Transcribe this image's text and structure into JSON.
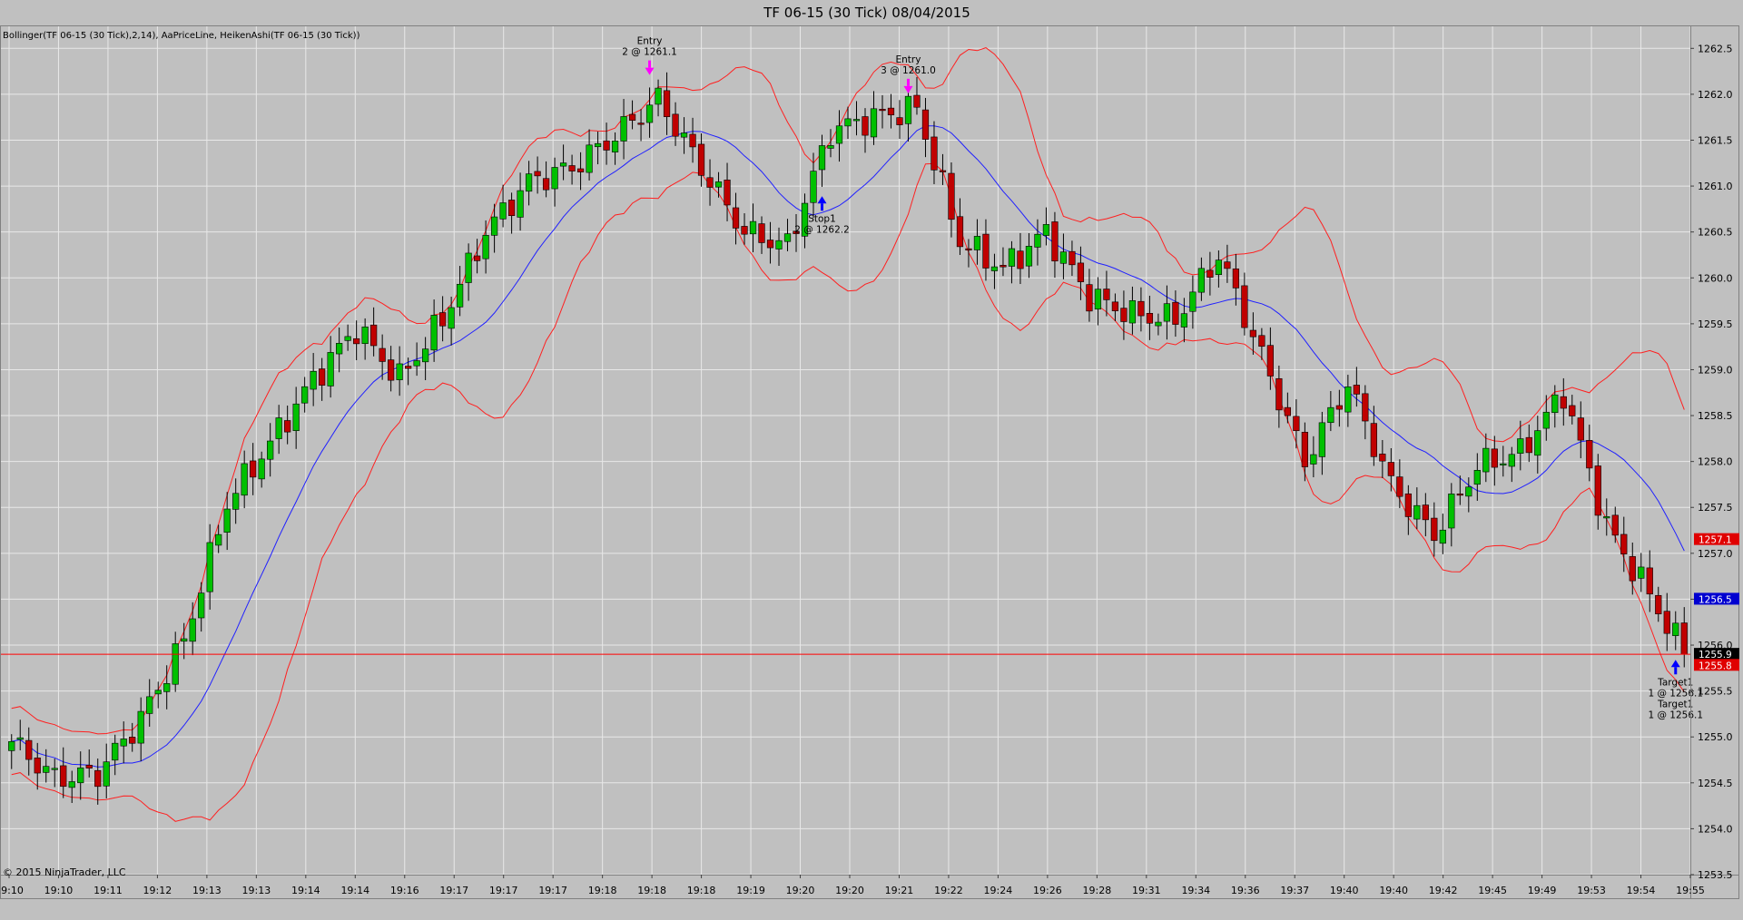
{
  "header": {
    "title": "TF 06-15 (30 Tick)  08/04/2015",
    "indicators": "Bollinger(TF 06-15 (30 Tick),2,14), AaPriceLine, HeikenAshi(TF 06-15 (30 Tick))",
    "copyright": "© 2015 NinjaTrader, LLC"
  },
  "colors": {
    "background": "#c0c0c0",
    "grid": "#e8e8e8",
    "up_candle": "#00c000",
    "down_candle": "#c00000",
    "upper_band": "#ff2020",
    "lower_band": "#ff2020",
    "middle_band": "#2020ff",
    "price_line": "#ff0000",
    "marker_entry": "#ff00ff",
    "marker_stop": "#0000ff"
  },
  "chart_data": {
    "type": "candlestick",
    "title": "TF 06-15 (30 Tick)  08/04/2015",
    "ylim": [
      1253.5,
      1262.75
    ],
    "y_ticks": [
      "1253.5",
      "1254.0",
      "1254.5",
      "1255.0",
      "1255.5",
      "1256.0",
      "1256.5",
      "1257.0",
      "1257.5",
      "1258.0",
      "1258.5",
      "1259.0",
      "1259.5",
      "1260.0",
      "1260.5",
      "1261.0",
      "1261.5",
      "1262.0",
      "1262.5"
    ],
    "x_ticks": [
      "19:10",
      "19:10",
      "19:11",
      "19:12",
      "19:13",
      "19:13",
      "19:14",
      "19:14",
      "19:16",
      "19:17",
      "19:17",
      "19:17",
      "19:18",
      "19:18",
      "19:18",
      "19:19",
      "19:20",
      "19:20",
      "19:21",
      "19:22",
      "19:24",
      "19:26",
      "19:28",
      "19:31",
      "19:34",
      "19:36",
      "19:37",
      "19:40",
      "19:40",
      "19:42",
      "19:45",
      "19:49",
      "19:53",
      "19:54",
      "19:55"
    ],
    "close_path": [
      [
        0,
        1254.95
      ],
      [
        5,
        1254.55
      ],
      [
        10,
        1254.6
      ],
      [
        15,
        1255.2
      ],
      [
        20,
        1256.05
      ],
      [
        25,
        1257.55
      ],
      [
        30,
        1258.2
      ],
      [
        35,
        1258.9
      ],
      [
        40,
        1259.45
      ],
      [
        45,
        1258.9
      ],
      [
        50,
        1259.55
      ],
      [
        55,
        1260.5
      ],
      [
        60,
        1261.05
      ],
      [
        65,
        1261.2
      ],
      [
        70,
        1261.55
      ],
      [
        75,
        1261.95
      ],
      [
        80,
        1261.2
      ],
      [
        85,
        1260.5
      ],
      [
        90,
        1260.35
      ],
      [
        95,
        1261.6
      ],
      [
        100,
        1261.75
      ],
      [
        105,
        1261.85
      ],
      [
        110,
        1260.4
      ],
      [
        115,
        1260.1
      ],
      [
        120,
        1260.5
      ],
      [
        125,
        1259.8
      ],
      [
        130,
        1259.6
      ],
      [
        135,
        1259.55
      ],
      [
        140,
        1260.25
      ],
      [
        145,
        1259.15
      ],
      [
        150,
        1258.0
      ],
      [
        155,
        1258.85
      ],
      [
        160,
        1257.75
      ],
      [
        165,
        1257.2
      ],
      [
        170,
        1257.95
      ],
      [
        175,
        1258.1
      ],
      [
        180,
        1258.75
      ],
      [
        185,
        1257.3
      ],
      [
        190,
        1256.55
      ],
      [
        194,
        1255.9
      ]
    ],
    "last_price": "1255.9",
    "price_labels": [
      {
        "text": "1257.1",
        "value": 1257.15,
        "color": "#e00000"
      },
      {
        "text": "1256.5",
        "value": 1256.5,
        "color": "#0000d0"
      },
      {
        "text": "1255.9",
        "value": 1255.9,
        "color": "#000000"
      },
      {
        "text": "1255.8",
        "value": 1255.78,
        "color": "#e00000"
      }
    ],
    "annotations": [
      {
        "lines": [
          "Entry",
          "2 @ 1261.1"
        ],
        "bar": 74,
        "value": 1262.25,
        "arrow": "down",
        "color": "#ff00ff"
      },
      {
        "lines": [
          "Stop1",
          "2 @ 1262.2"
        ],
        "bar": 94,
        "value": 1260.85,
        "arrow": "up",
        "color": "#0000ff"
      },
      {
        "lines": [
          "Entry",
          "3 @ 1261.0"
        ],
        "bar": 104,
        "value": 1262.05,
        "arrow": "down",
        "color": "#ff00ff"
      },
      {
        "lines": [
          "Target1",
          "1 @ 1256.1",
          "Target1",
          "1 @ 1256.1"
        ],
        "bar": 193,
        "value": 1255.8,
        "arrow": "up",
        "color": "#0000ff"
      }
    ]
  }
}
